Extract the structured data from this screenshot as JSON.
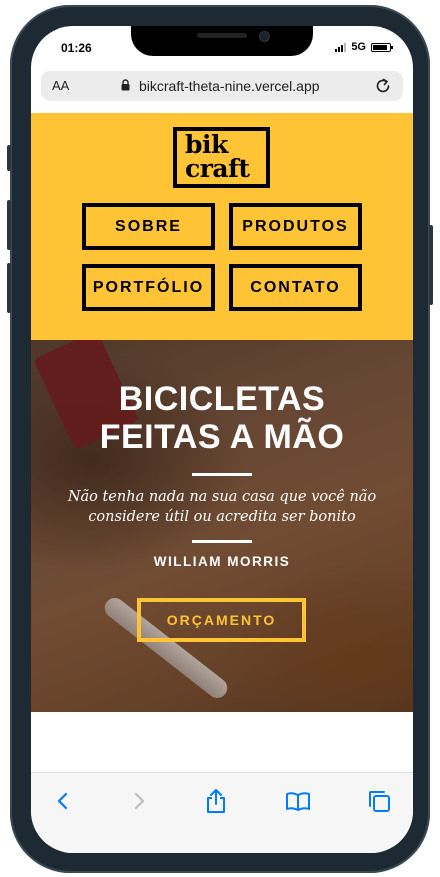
{
  "status_bar": {
    "time": "01:26",
    "network": "5G"
  },
  "browser": {
    "aa_label": "AA",
    "url": "bikcraft-theta-nine.vercel.app",
    "accent_color": "#007aff"
  },
  "site": {
    "brand_color": "#ffc336",
    "logo_line1": "bik",
    "logo_line2": "craft",
    "nav": [
      {
        "label": "SOBRE"
      },
      {
        "label": "PRODUTOS"
      },
      {
        "label": "PORTFÓLIO"
      },
      {
        "label": "CONTATO"
      }
    ],
    "hero": {
      "title": "BICICLETAS\nFEITAS A MÃO",
      "quote": "Não tenha nada na sua casa que você não considere útil ou acredita ser bonito",
      "author": "WILLIAM MORRIS",
      "cta_label": "ORÇAMENTO"
    }
  },
  "toolbar": {
    "icons": [
      "back-icon",
      "forward-icon",
      "share-icon",
      "bookmarks-icon",
      "tabs-icon"
    ]
  }
}
